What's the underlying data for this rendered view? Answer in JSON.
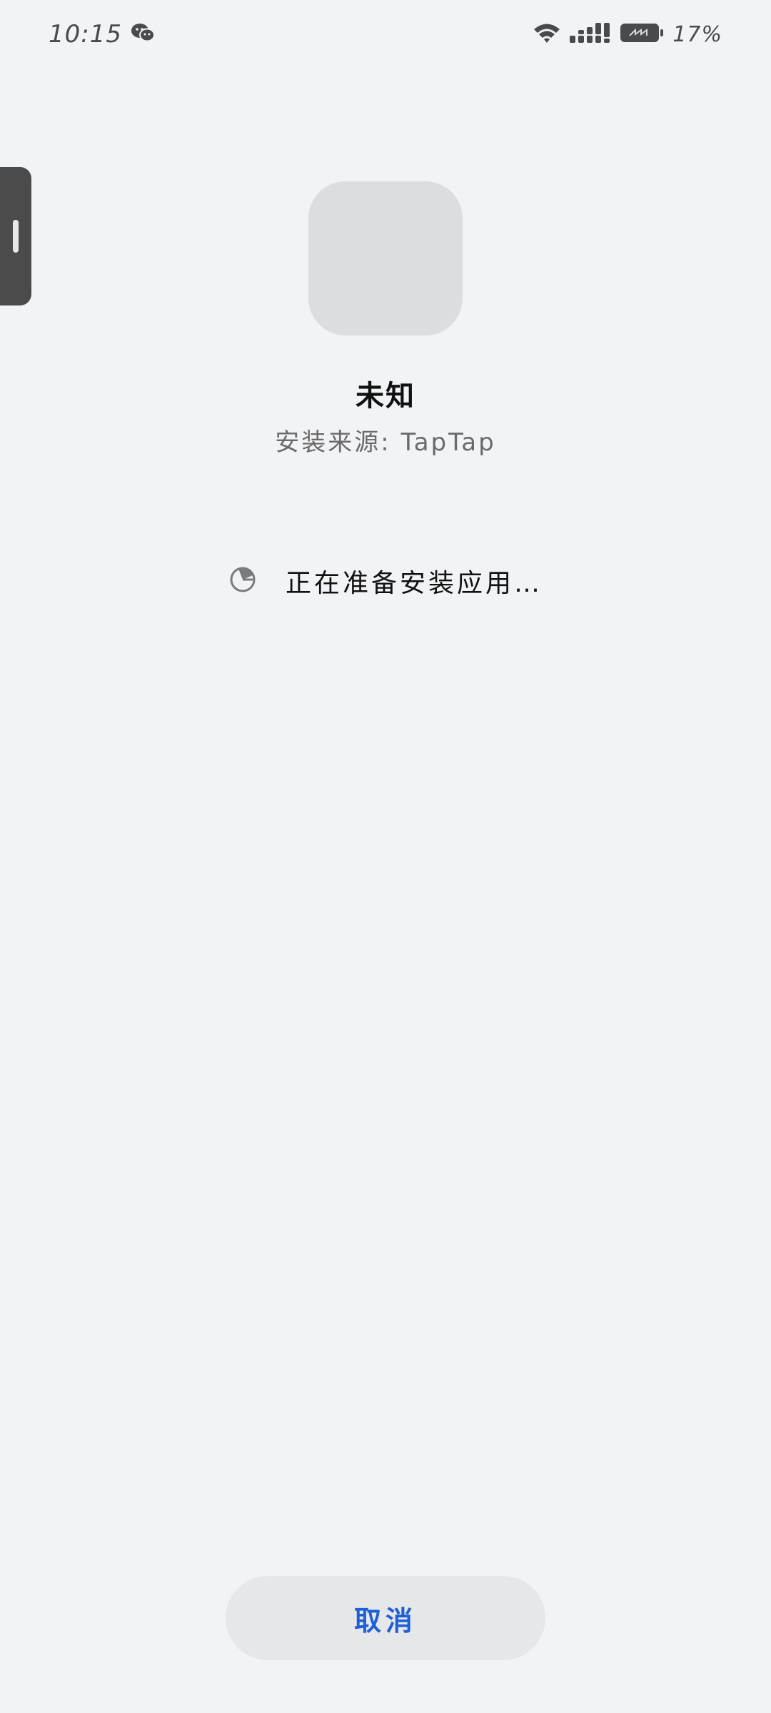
{
  "status_bar": {
    "time": "10:15",
    "battery_percent": "17%",
    "icons": [
      "wechat-icon",
      "wifi-icon",
      "signal-icon",
      "battery-icon"
    ]
  },
  "app": {
    "name": "未知",
    "install_source": "安装来源: TapTap"
  },
  "progress": {
    "message": "正在准备安装应用…"
  },
  "actions": {
    "cancel_label": "取消"
  },
  "colors": {
    "background": "#F2F3F5",
    "accent": "#1D5FD6",
    "icon_placeholder": "#DCDDDF"
  }
}
